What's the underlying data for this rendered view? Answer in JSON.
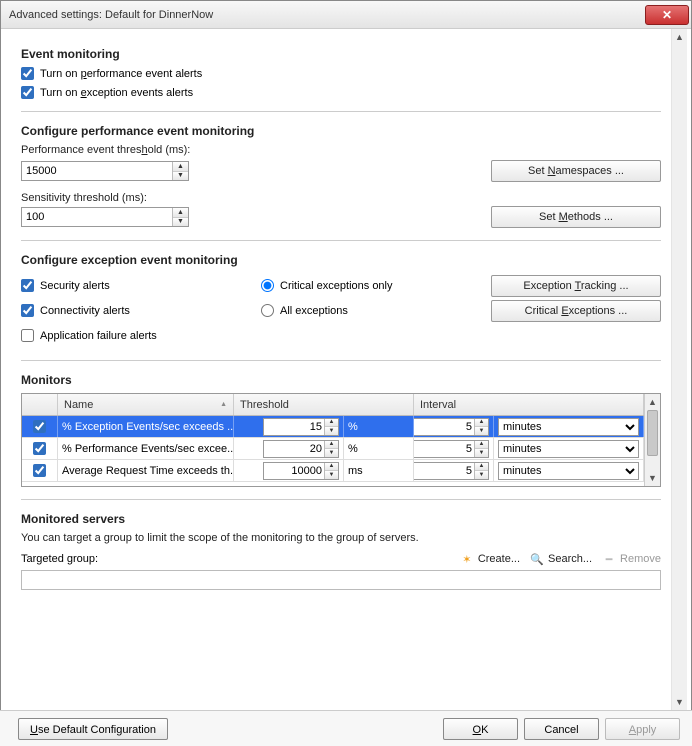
{
  "window": {
    "title": "Advanced settings: Default for DinnerNow",
    "close_icon": "✕"
  },
  "event_monitoring": {
    "heading": "Event monitoring",
    "perf_alerts_label": "Turn on performance event alerts",
    "perf_alerts_ak": "p",
    "exception_alerts_label": "Turn on exception events alerts",
    "exception_alerts_ak": "e",
    "perf_alerts_checked": true,
    "exception_alerts_checked": true
  },
  "perf_config": {
    "heading": "Configure performance event monitoring",
    "threshold_label": "Performance event threshold (ms):",
    "threshold_ak": "h",
    "threshold_value": "15000",
    "sensitivity_label": "Sensitivity threshold (ms):",
    "sensitivity_value": "100",
    "btn_namespaces": "Set Namespaces ...",
    "btn_namespaces_ak": "N",
    "btn_methods": "Set Methods ...",
    "btn_methods_ak": "M"
  },
  "exception_config": {
    "heading": "Configure exception event monitoring",
    "security_label": "Security alerts",
    "security_checked": true,
    "connectivity_label": "Connectivity alerts",
    "connectivity_checked": true,
    "appfail_label": "Application failure alerts",
    "appfail_checked": false,
    "radio_critical": "Critical exceptions only",
    "radio_all": "All exceptions",
    "radio_selected": "critical",
    "btn_tracking": "Exception Tracking ...",
    "btn_tracking_ak": "T",
    "btn_critical": "Critical Exceptions ...",
    "btn_critical_ak": "E"
  },
  "monitors": {
    "heading": "Monitors",
    "columns": {
      "name": "Name",
      "threshold": "Threshold",
      "interval": "Interval"
    },
    "rows": [
      {
        "checked": true,
        "selected": true,
        "name": "% Exception Events/sec exceeds ...",
        "threshold": "15",
        "threshold_unit": "%",
        "interval": "5",
        "interval_unit": "minutes"
      },
      {
        "checked": true,
        "selected": false,
        "name": "% Performance Events/sec excee...",
        "threshold": "20",
        "threshold_unit": "%",
        "interval": "5",
        "interval_unit": "minutes"
      },
      {
        "checked": true,
        "selected": false,
        "name": "Average Request Time exceeds th...",
        "threshold": "10000",
        "threshold_unit": "ms",
        "interval": "5",
        "interval_unit": "minutes"
      }
    ]
  },
  "monitored_servers": {
    "heading": "Monitored servers",
    "description": "You can target a group to limit the scope of the monitoring to the group of servers.",
    "targeted_label": "Targeted group:",
    "create_label": "Create...",
    "search_label": "Search...",
    "remove_label": "Remove"
  },
  "footer": {
    "use_default": "Use Default Configuration",
    "use_default_ak": "U",
    "ok": "OK",
    "ok_ak": "O",
    "cancel": "Cancel",
    "apply": "Apply",
    "apply_ak": "A"
  },
  "colors": {
    "selection": "#2f6fed"
  }
}
